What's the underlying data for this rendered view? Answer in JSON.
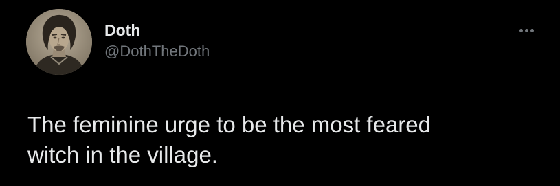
{
  "author": {
    "display_name": "Doth",
    "handle": "@DothTheDoth",
    "avatar": "sepia-portrait-avatar"
  },
  "actions": {
    "more_icon": "more-horizontal-icon"
  },
  "tweet": {
    "text_line_1": "The feminine urge to be the most feared",
    "text_line_2": "witch in the village."
  },
  "colors": {
    "background": "#000000",
    "primary_text": "#e7e9ea",
    "secondary_text": "#71767b"
  }
}
